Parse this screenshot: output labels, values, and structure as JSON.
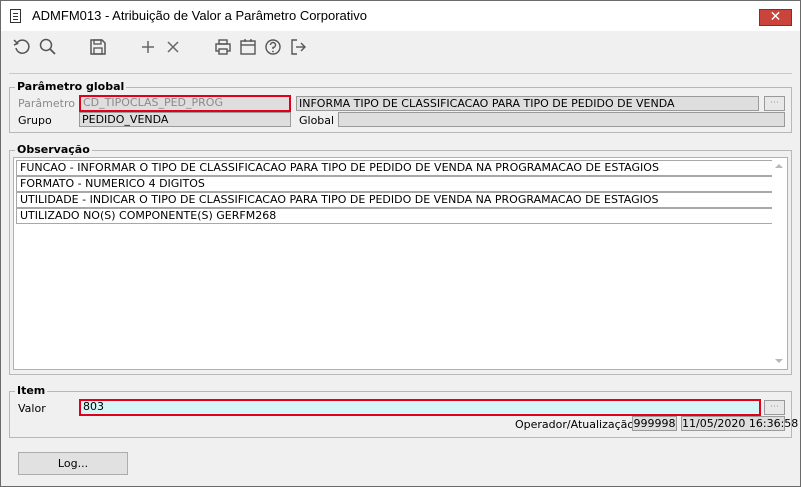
{
  "window": {
    "title": "ADMFM013 - Atribuição de Valor a Parâmetro Corporativo",
    "close_glyph": "✕"
  },
  "toolbar": {
    "buttons": [
      {
        "name": "refresh",
        "icon": "refresh-icon"
      },
      {
        "name": "search",
        "icon": "search-icon"
      },
      {
        "name": "save",
        "icon": "save-icon"
      },
      {
        "name": "add",
        "icon": "add-icon"
      },
      {
        "name": "delete",
        "icon": "delete-icon"
      },
      {
        "name": "print",
        "icon": "printer-icon"
      },
      {
        "name": "calendar",
        "icon": "calendar-icon"
      },
      {
        "name": "help",
        "icon": "help-icon"
      },
      {
        "name": "exit",
        "icon": "exit-icon"
      }
    ]
  },
  "parametro_global": {
    "title": "Parâmetro global",
    "parametro_label": "Parâmetro",
    "parametro_value": "CD_TIPOCLAS_PED_PROG",
    "descricao_value": "INFORMA TIPO DE CLASSIFICACAO PARA TIPO DE PEDIDO DE VENDA",
    "grupo_label": "Grupo",
    "grupo_value": "PEDIDO_VENDA",
    "global_label": "Global",
    "global_value": ""
  },
  "observacao": {
    "title": "Observação",
    "lines": [
      "FUNCAO - INFORMAR O TIPO DE CLASSIFICACAO PARA TIPO DE PEDIDO DE VENDA NA PROGRAMACAO DE ESTAGIOS",
      "FORMATO - NUMERICO 4 DIGITOS",
      "UTILIDADE - INDICAR O TIPO DE CLASSIFICACAO PARA TIPO DE PEDIDO DE VENDA NA PROGRAMACAO DE ESTAGIOS",
      "UTILIZADO NO(S) COMPONENTE(S) GERFM268"
    ]
  },
  "item": {
    "title": "Item",
    "valor_label": "Valor",
    "valor_value": "803",
    "operador_label": "Operador/Atualização",
    "operador_value": "999998",
    "atualizacao_value": "11/05/2020 16:36:58"
  },
  "footer": {
    "log_label": "Log..."
  },
  "colors": {
    "highlight_border": "#e0001a",
    "valor_background": "#d4f6f6",
    "close_button": "#c9443a"
  }
}
